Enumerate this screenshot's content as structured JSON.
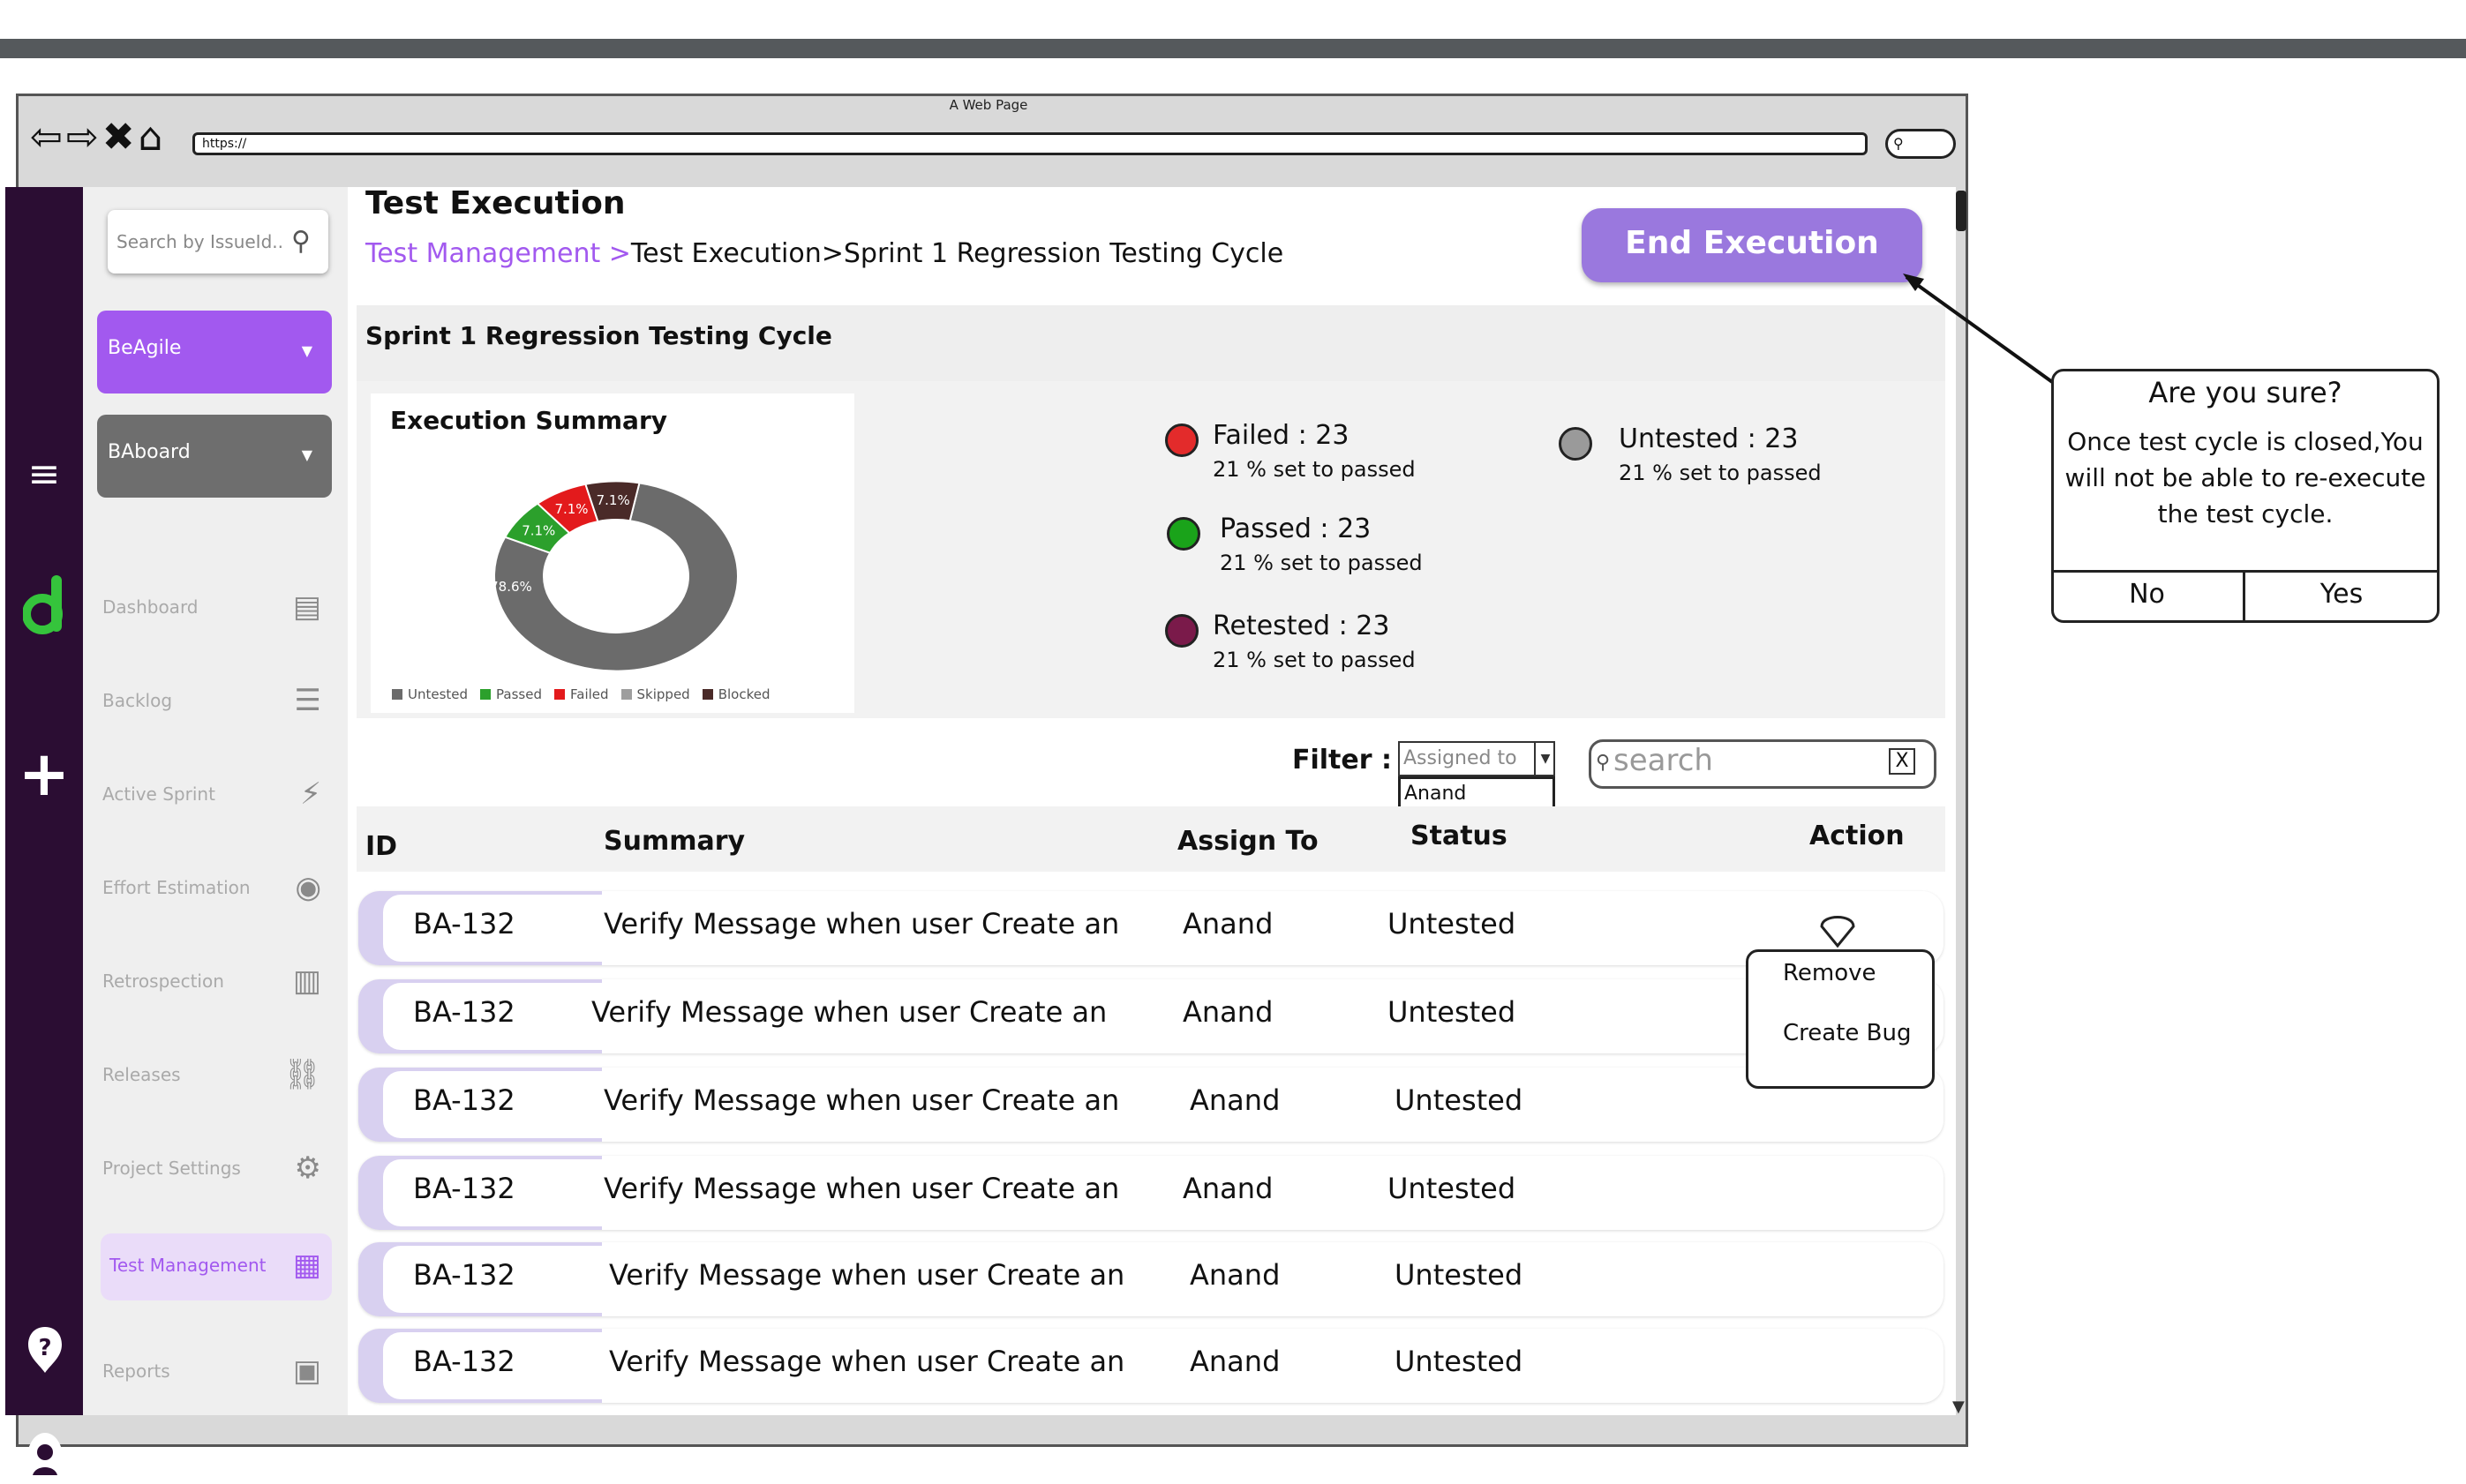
{
  "browser": {
    "window_title": "A Web Page",
    "url": "https://"
  },
  "sidebar": {
    "search_placeholder": "Search by IssueId...",
    "projects": [
      {
        "label": "BeAgile"
      },
      {
        "label": "BAboard"
      }
    ],
    "nav": [
      {
        "label": "Dashboard",
        "icon": "dashboard-icon"
      },
      {
        "label": "Backlog",
        "icon": "backlog-icon"
      },
      {
        "label": "Active Sprint",
        "icon": "sprint-icon"
      },
      {
        "label": "Effort Estimation",
        "icon": "estimation-icon"
      },
      {
        "label": "Retrospection",
        "icon": "retrospection-icon"
      },
      {
        "label": "Releases",
        "icon": "releases-icon"
      },
      {
        "label": "Project Settings",
        "icon": "settings-icon"
      },
      {
        "label": "Test Management",
        "icon": "test-management-icon"
      },
      {
        "label": "Reports",
        "icon": "reports-icon"
      }
    ]
  },
  "header": {
    "title": "Test Execution",
    "breadcrumb_link": "Test Management >",
    "breadcrumb_rest": "Test Execution>Sprint 1 Regression Testing Cycle",
    "end_button": "End Execution"
  },
  "cycle": {
    "title": "Sprint 1 Regression Testing Cycle"
  },
  "summary": {
    "title": "Execution Summary",
    "stats": [
      {
        "label": "Failed : 23",
        "sub": "21 % set to passed",
        "color": "#e32b2b"
      },
      {
        "label": "Passed : 23",
        "sub": "21 % set to passed",
        "color": "#1aa31a"
      },
      {
        "label": "Retested : 23",
        "sub": "21 % set to passed",
        "color": "#7a1a4a"
      },
      {
        "label": "Untested : 23",
        "sub": "21 % set to passed",
        "color": "#9a9a9a"
      }
    ]
  },
  "chart_data": {
    "type": "pie",
    "donut": true,
    "categories": [
      "Untested",
      "Passed",
      "Failed",
      "Skipped",
      "Blocked"
    ],
    "values": [
      78.6,
      7.1,
      7.1,
      0,
      7.1
    ],
    "data_labels": [
      "78.6%",
      "7.1%",
      "7.1%",
      "",
      "7.1%"
    ],
    "colors": [
      "#6b6b6b",
      "#2ca02c",
      "#e31a1c",
      "#9e9e9e",
      "#4a2a28"
    ],
    "legend": "bottom"
  },
  "filter": {
    "label": "Filter :",
    "select_placeholder": "Assigned to",
    "select_option": "Anand",
    "search_placeholder": "search",
    "clear": "X"
  },
  "table": {
    "headers": {
      "id": "ID",
      "summary": "Summary",
      "assign": "Assign To",
      "status": "Status",
      "action": "Action"
    },
    "rows": [
      {
        "id": "BA-132",
        "summary": "Verify Message when user Create an",
        "assign": "Anand",
        "status": "Untested"
      },
      {
        "id": "BA-132",
        "summary": "Verify Message when user Create an",
        "assign": "Anand",
        "status": "Untested"
      },
      {
        "id": "BA-132",
        "summary": "Verify Message when user Create an",
        "assign": "Anand",
        "status": "Untested"
      },
      {
        "id": "BA-132",
        "summary": "Verify Message when user Create an",
        "assign": "Anand",
        "status": "Untested"
      },
      {
        "id": "BA-132",
        "summary": "Verify Message when user Create an",
        "assign": "Anand",
        "status": "Untested"
      },
      {
        "id": "BA-132",
        "summary": "Verify Message when user Create an",
        "assign": "Anand",
        "status": "Untested"
      }
    ]
  },
  "action_menu": {
    "remove": "Remove",
    "create_bug": "Create Bug"
  },
  "confirm": {
    "title": "Are you sure?",
    "message": "Once test cycle is closed,You will not be able to re-execute the test cycle.",
    "no": "No",
    "yes": "Yes"
  }
}
